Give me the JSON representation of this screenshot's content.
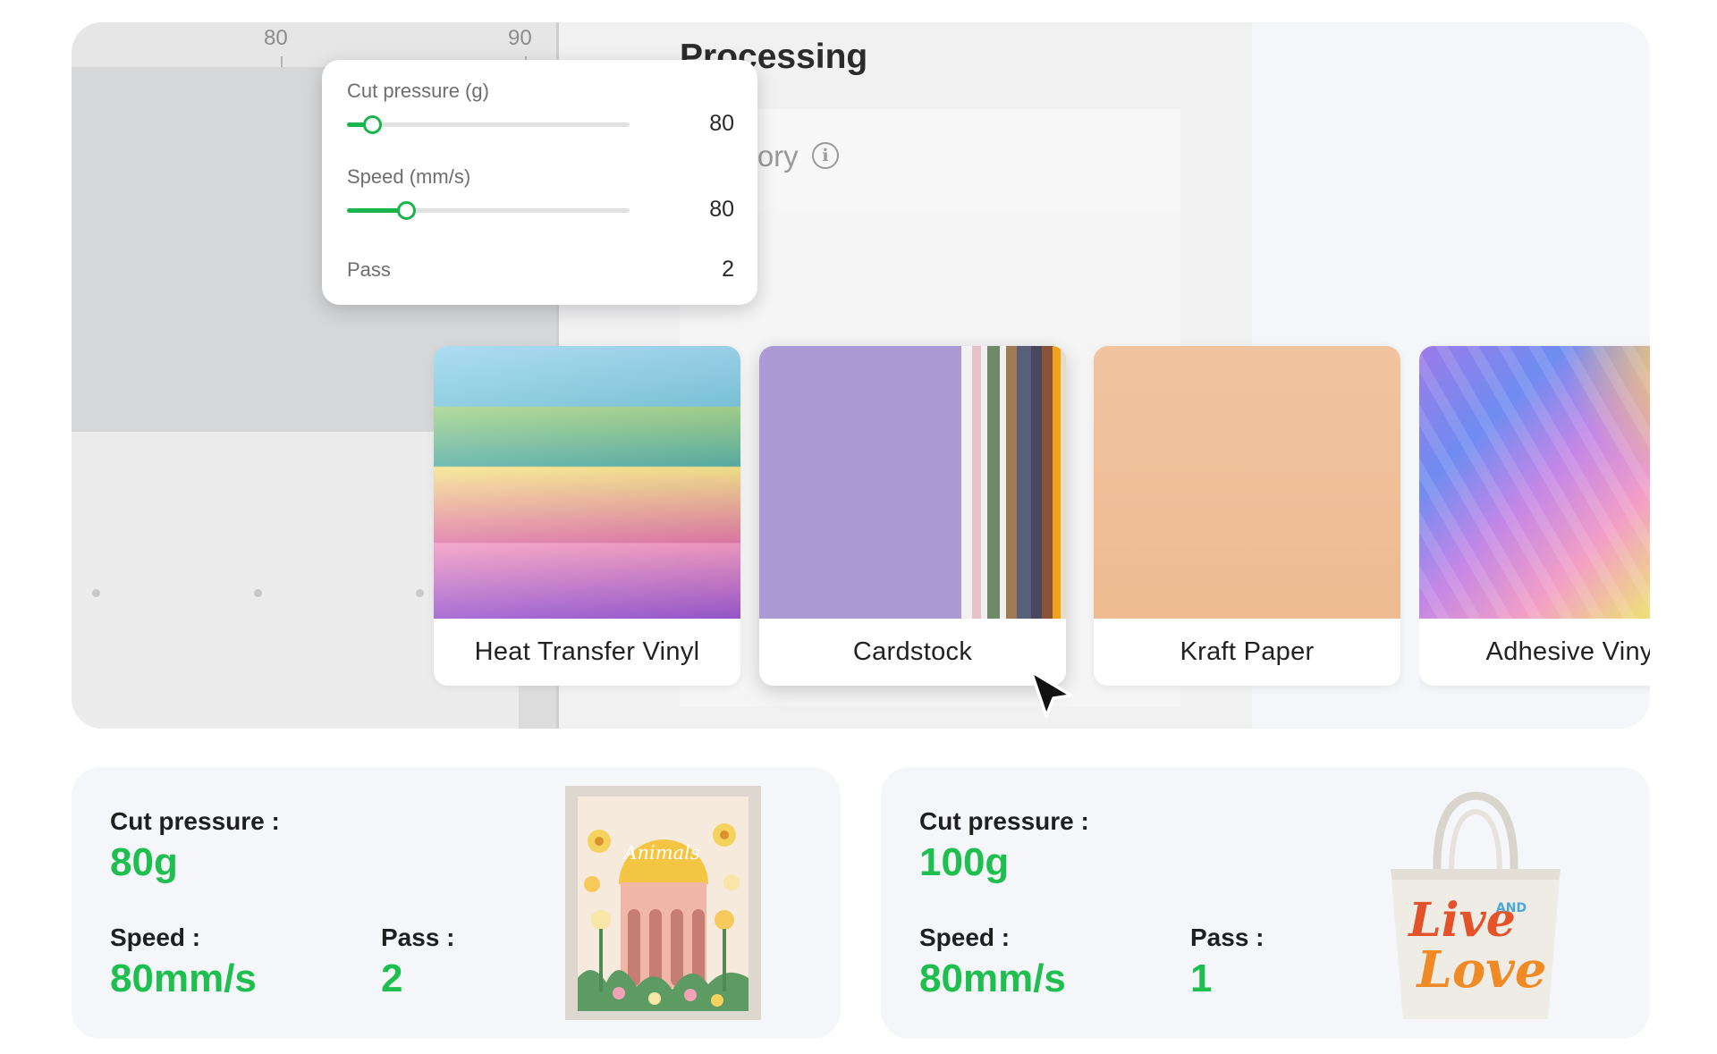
{
  "ruler": {
    "labels": [
      "80",
      "90"
    ]
  },
  "panel": {
    "title": "Processing",
    "history_label": "History"
  },
  "settings_popup": {
    "cut_pressure_label": "Cut pressure (g)",
    "cut_pressure_value": "80",
    "cut_pressure_fill": 0.09,
    "speed_label": "Speed (mm/s)",
    "speed_value": "80",
    "speed_fill": 0.21,
    "pass_label": "Pass",
    "pass_value": "2"
  },
  "materials": [
    {
      "label": "Heat Transfer Vinyl"
    },
    {
      "label": "Cardstock",
      "selected": true
    },
    {
      "label": "Kraft Paper"
    },
    {
      "label": "Adhesive Vinyl"
    }
  ],
  "presets": [
    {
      "cut_pressure_label": "Cut pressure :",
      "cut_pressure_value": "80g",
      "speed_label": "Speed :",
      "speed_value": "80mm/s",
      "pass_label": "Pass :",
      "pass_value": "2",
      "image_text": "Animals"
    },
    {
      "cut_pressure_label": "Cut pressure :",
      "cut_pressure_value": "100g",
      "speed_label": "Speed :",
      "speed_value": "80mm/s",
      "pass_label": "Pass :",
      "pass_value": "1",
      "image_text_1": "Live",
      "image_text_2": "AND",
      "image_text_3": "Love"
    }
  ],
  "colors": {
    "accent": "#1fbf4f",
    "slider": "#17b54c"
  }
}
